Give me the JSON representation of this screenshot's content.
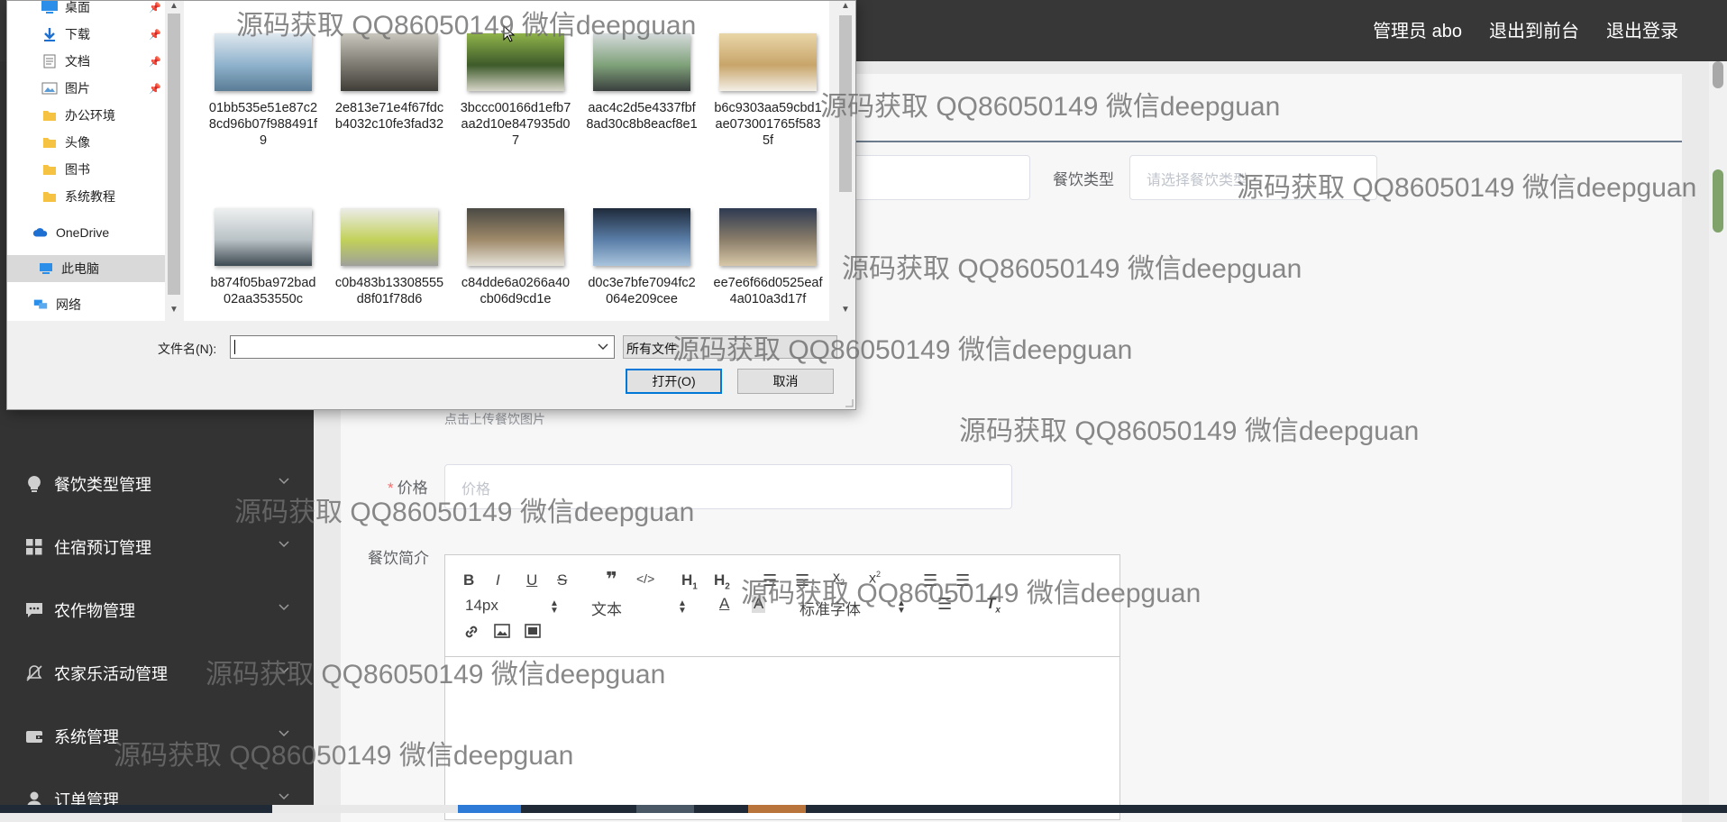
{
  "header": {
    "user": "管理员 abo",
    "to_front": "退出到前台",
    "logout": "退出登录"
  },
  "sidebar": {
    "items": [
      {
        "label": "餐饮类型管理",
        "icon": "bulb-icon"
      },
      {
        "label": "住宿预订管理",
        "icon": "grid-icon"
      },
      {
        "label": "农作物管理",
        "icon": "chat-icon"
      },
      {
        "label": "农家乐活动管理",
        "icon": "bell-off-icon"
      },
      {
        "label": "系统管理",
        "icon": "wallet-icon"
      },
      {
        "label": "订单管理",
        "icon": "user-icon"
      }
    ]
  },
  "form": {
    "type_label": "餐饮类型",
    "type_placeholder": "请选择餐饮类型",
    "upload_hint": "点击上传餐饮图片",
    "price_label": "价格",
    "price_placeholder": "价格",
    "intro_label": "餐饮简介",
    "editor": {
      "font_size": "14px",
      "paragraph": "文本",
      "font_family": "标准字体"
    }
  },
  "dialog": {
    "nav": [
      {
        "label": "桌面",
        "icon": "desktop-icon",
        "pinned": true
      },
      {
        "label": "下载",
        "icon": "download-icon",
        "pinned": true
      },
      {
        "label": "文档",
        "icon": "document-icon",
        "pinned": true
      },
      {
        "label": "图片",
        "icon": "pictures-icon",
        "pinned": true
      },
      {
        "label": "办公环境",
        "icon": "folder-icon",
        "pinned": false
      },
      {
        "label": "头像",
        "icon": "folder-icon",
        "pinned": false
      },
      {
        "label": "图书",
        "icon": "folder-icon",
        "pinned": false
      },
      {
        "label": "系统教程",
        "icon": "folder-icon",
        "pinned": false
      },
      {
        "label": "OneDrive",
        "icon": "cloud-icon",
        "pinned": false
      },
      {
        "label": "此电脑",
        "icon": "computer-icon",
        "pinned": false
      },
      {
        "label": "网络",
        "icon": "network-icon",
        "pinned": false
      }
    ],
    "files": [
      {
        "name": "01bb535e51e87c28cd96b07f988491f9",
        "colors": [
          "#dfe8ef",
          "#8fb2cc",
          "#5a7c95"
        ]
      },
      {
        "name": "2e813e71e4f67fdcb4032c10fe3fad32",
        "colors": [
          "#c9c7bd",
          "#7c7a70",
          "#3f3d37"
        ]
      },
      {
        "name": "3bccc00166d1efb7aa2d10e847935d07",
        "colors": [
          "#8fb34a",
          "#3d5a2a",
          "#d8d6c9"
        ]
      },
      {
        "name": "aac4c2d5e4337fbf8ad30c8b8eacf8e1",
        "colors": [
          "#d5dadb",
          "#7fa27a",
          "#3a3f3e"
        ]
      },
      {
        "name": "b6c9303aa59cbd1ae073001765f5835f",
        "colors": [
          "#e9d6a8",
          "#c8a56a",
          "#f3efe6"
        ]
      },
      {
        "name": "b874f05ba972bad02aa353550c",
        "colors": [
          "#eef0f0",
          "#b9c2c6",
          "#3e4a52"
        ]
      },
      {
        "name": "c0b483b13308555d8f01f78d6",
        "colors": [
          "#ecece8",
          "#c2d15a",
          "#9ea09a"
        ]
      },
      {
        "name": "c84dde6a0266a40cb06d9cd1e",
        "colors": [
          "#4a4a44",
          "#a08a6a",
          "#e5e2d8"
        ]
      },
      {
        "name": "d0c3e7bfe7094fc2064e209cee",
        "colors": [
          "#1f2b3b",
          "#5a7ea8",
          "#a9c4dc"
        ]
      },
      {
        "name": "ee7e6f66d0525eaf4a010a3d17f",
        "colors": [
          "#2d3a52",
          "#8b7e6a",
          "#d8c8a8"
        ]
      }
    ],
    "filename_label": "文件名(N):",
    "filename_value": "",
    "filetype": "所有文件",
    "open_button": "打开(O)",
    "cancel_button": "取消"
  },
  "watermark": "源码获取 QQ86050149 微信deepguan"
}
